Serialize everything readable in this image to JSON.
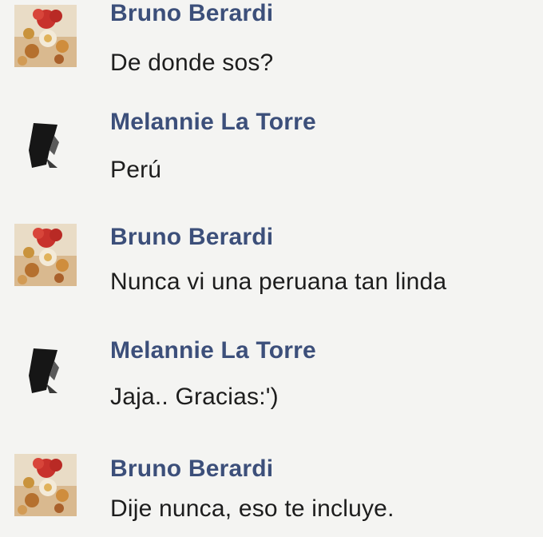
{
  "messages": [
    {
      "sender": "Bruno Berardi",
      "text": "De donde sos?",
      "avatar_icon": "flower-photo-avatar-icon"
    },
    {
      "sender": "Melannie La Torre",
      "text": "Perú",
      "avatar_icon": "dark-profile-avatar-icon"
    },
    {
      "sender": "Bruno Berardi",
      "text": "Nunca vi una peruana tan linda",
      "avatar_icon": "flower-photo-avatar-icon"
    },
    {
      "sender": "Melannie La Torre",
      "text": "Jaja.. Gracias:')",
      "avatar_icon": "dark-profile-avatar-icon"
    },
    {
      "sender": "Bruno Berardi",
      "text": "Dije nunca, eso te incluye.",
      "avatar_icon": "flower-photo-avatar-icon"
    }
  ],
  "colors": {
    "background": "#f4f4f2",
    "sender_name": "#3c4f7a",
    "message_text": "#1d1d1d"
  }
}
